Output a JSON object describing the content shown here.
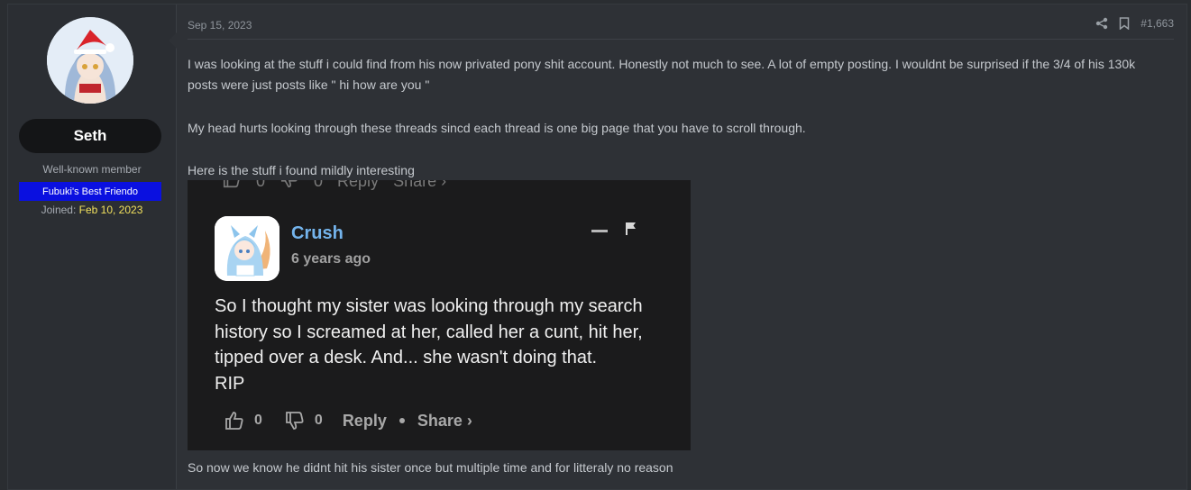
{
  "user": {
    "name": "Seth",
    "title": "Well-known member",
    "banner": "Fubuki's Best Friendo",
    "joined_label": "Joined:",
    "joined_date": "Feb 10, 2023"
  },
  "post": {
    "date": "Sep 15, 2023",
    "number": "#1,663",
    "paragraphs": [
      "I was looking at the stuff i could find from his now privated pony shit account. Honestly not much to see. A lot of empty posting. I wouldnt be surprised if the 3/4 of his 130k posts were just posts like \" hi how are you \"",
      "My head hurts looking through these threads sincd each thread is one big page that you have to scroll through.",
      "Here is the stuff i found mildly interesting"
    ],
    "after_text": "So now we know he didnt hit his sister once but multiple time and for litteraly no reason"
  },
  "embed": {
    "faded_row": {
      "likes": "0",
      "dislikes": "0",
      "reply": "Reply",
      "share": "Share ›"
    },
    "commenter": "Crush",
    "time_ago": "6 years ago",
    "body_lines": [
      "So I thought my sister was looking through my search",
      "history so I screamed at her, called her a cunt, hit her,",
      "tipped over a desk. And... she wasn't doing that.",
      "RIP"
    ],
    "likes": "0",
    "dislikes": "0",
    "reply_label": "Reply",
    "share_label": "Share ›"
  },
  "icons": [
    "share-icon",
    "bookmark-icon",
    "thumbs-up-icon",
    "thumbs-down-icon",
    "minimize-icon",
    "flag-icon"
  ],
  "colors": {
    "banner_bg": "#0a10e0",
    "joined_date": "#f2e15e",
    "commenter_name": "#74b4ec",
    "embed_bg": "#1b1b1c"
  }
}
